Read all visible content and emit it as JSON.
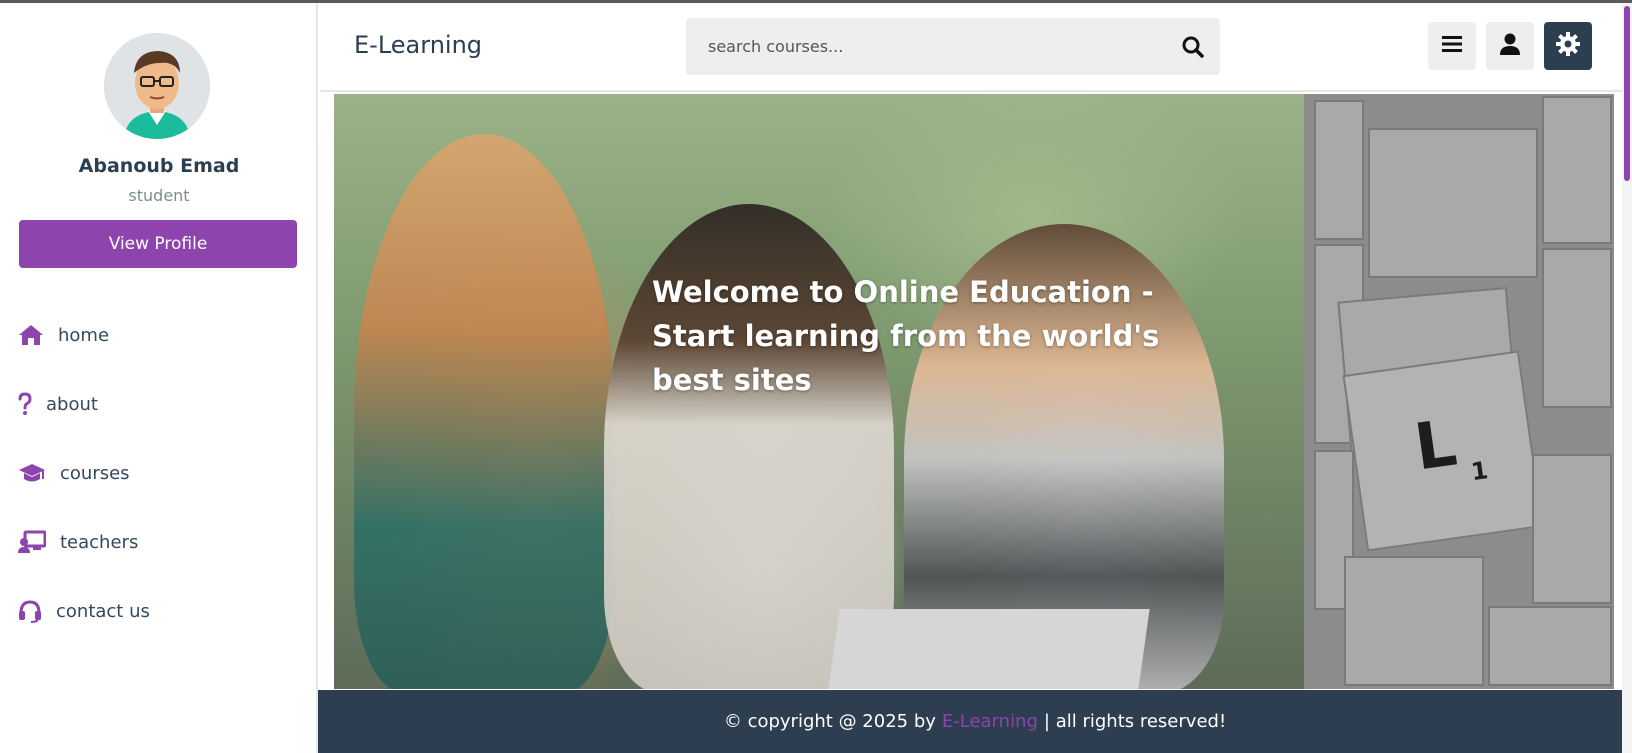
{
  "colors": {
    "accent": "#8e44ad",
    "dark": "#2c3e50",
    "light_bg": "#eeeeee"
  },
  "sidebar": {
    "user_name": "Abanoub Emad",
    "user_role": "student",
    "view_profile_label": "View Profile",
    "items": [
      {
        "label": "home",
        "icon": "home-icon"
      },
      {
        "label": "about",
        "icon": "question-icon"
      },
      {
        "label": "courses",
        "icon": "graduation-cap-icon"
      },
      {
        "label": "teachers",
        "icon": "chalkboard-teacher-icon"
      },
      {
        "label": "contact us",
        "icon": "headset-icon"
      }
    ]
  },
  "header": {
    "logo": "E-Learning",
    "search_placeholder": "search courses...",
    "buttons": [
      "menu-icon",
      "user-icon",
      "gear-icon"
    ]
  },
  "hero": {
    "heading": "Welcome to Online Education - Start learning from the world's best sites",
    "tile_letter": "L",
    "tile_score": "1"
  },
  "footer": {
    "prefix": "© copyright @ 2025 by",
    "brand": "E-Learning",
    "suffix": "| all rights reserved!"
  }
}
